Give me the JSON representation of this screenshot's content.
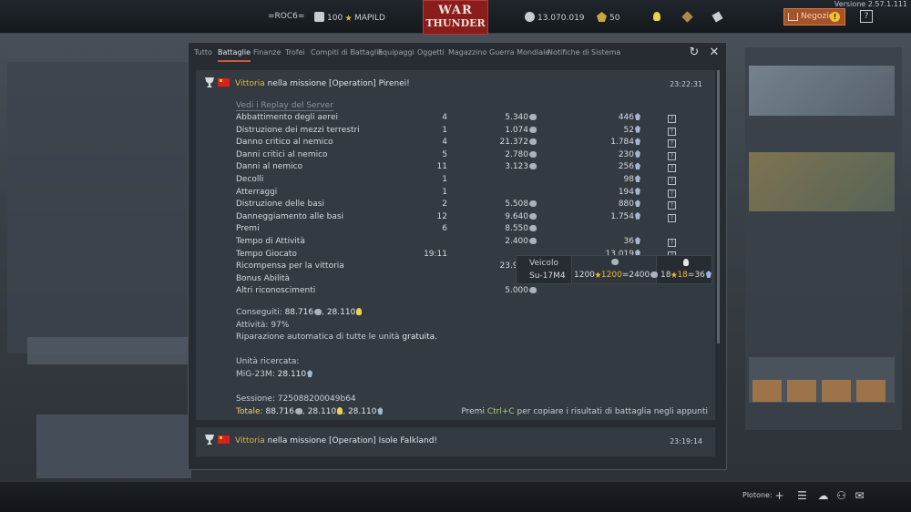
{
  "topbar": {
    "version": "Versione 2.57.1.111",
    "player": "=ROC6=",
    "rank_icon": "rank-insignia-icon",
    "level": "100",
    "mapid": "MAPILD",
    "logo_line1": "WAR",
    "logo_line2": "THUNDER",
    "silver_lions": "13.070.019",
    "golden_eagles": "50",
    "shop_label": "Negozio",
    "shop_alert": "!",
    "help": "?"
  },
  "tabs": [
    {
      "label": "Tutto"
    },
    {
      "label": "Battaglie"
    },
    {
      "label": "Finanze"
    },
    {
      "label": "Trofei"
    },
    {
      "label": "Compiti di Battaglia"
    },
    {
      "label": "Equipaggi"
    },
    {
      "label": "Oggetti"
    },
    {
      "label": "Magazzino"
    },
    {
      "label": "Guerra Mondiale"
    },
    {
      "label": "Notifiche di Sistema"
    }
  ],
  "active_tab": "Battaglie",
  "entry1": {
    "victory": "Vittoria",
    "title_rest": "nella missione [Operation] Pirenei!",
    "time": "23:22:31",
    "replay_link": "Vedi i Replay del Server",
    "rows": [
      {
        "label": "Abbattimento degli aerei",
        "count": "4",
        "lions": "5.340",
        "rp": "446"
      },
      {
        "label": "Distruzione dei mezzi terrestri",
        "count": "1",
        "lions": "1.074",
        "rp": "52"
      },
      {
        "label": "Danno critico al nemico",
        "count": "4",
        "lions": "21.372",
        "rp": "1.784"
      },
      {
        "label": "Danni critici al nemico",
        "count": "5",
        "lions": "2.780",
        "rp": "230"
      },
      {
        "label": "Danni al nemico",
        "count": "11",
        "lions": "3.123",
        "rp": "256"
      },
      {
        "label": "Decolli",
        "count": "1",
        "lions": "",
        "rp": "98"
      },
      {
        "label": "Atterraggi",
        "count": "1",
        "lions": "",
        "rp": "194"
      },
      {
        "label": "Distruzione delle basi",
        "count": "2",
        "lions": "5.508",
        "rp": "880"
      },
      {
        "label": "Danneggiamento alle basi",
        "count": "12",
        "lions": "9.640",
        "rp": "1.754"
      },
      {
        "label": "Premi",
        "count": "6",
        "lions": "8.550",
        "rp": ""
      },
      {
        "label": "Tempo di Attività",
        "count": "",
        "lions": "2.400",
        "rp": "36"
      },
      {
        "label": "Tempo Giocato",
        "count": "19:11",
        "lions": "",
        "rp": "13.019"
      },
      {
        "label": "Ricompensa per la vittoria",
        "count": "",
        "lions": "23.929",
        "rp": ""
      },
      {
        "label": "Bonus Abilità",
        "count": "",
        "lions": "",
        "rp": ""
      },
      {
        "label": "Altri riconoscimenti",
        "count": "",
        "lions": "5.000",
        "rp": ""
      }
    ],
    "earned_label": "Conseguiti:",
    "earned_lions": "88.716",
    "earned_rp": "28.110",
    "activity": "Attività: 97%",
    "repair_pre": "Riparazione automatica di tutte le unità",
    "repair_free": "gratuita.",
    "researched_label": "Unità ricercata:",
    "researched_unit": "MiG-23M:",
    "researched_rp": "28.110",
    "session": "Sessione: 725088200049b64",
    "total_label": "Totale:",
    "total_lions": "88.716",
    "total_rp1": "28.110",
    "total_rp2": "28.110",
    "hint_pre": "Premi",
    "hint_key": "Ctrl+C",
    "hint_post": "per copiare i risultati di battaglia negli appunti"
  },
  "popup": {
    "label": "Veicolo",
    "vehicle": "Su-17M4",
    "lions_base": "1200",
    "lions_bonus": "1200",
    "lions_total": "=2400",
    "rp_base": "18",
    "rp_bonus": "18",
    "rp_total": "=36"
  },
  "entry2": {
    "victory": "Vittoria",
    "title_rest": "nella missione [Operation] Isole Falkland!",
    "time": "23:19:14"
  },
  "bottombar": {
    "squad_label": "Plotone:",
    "plus": "+"
  }
}
